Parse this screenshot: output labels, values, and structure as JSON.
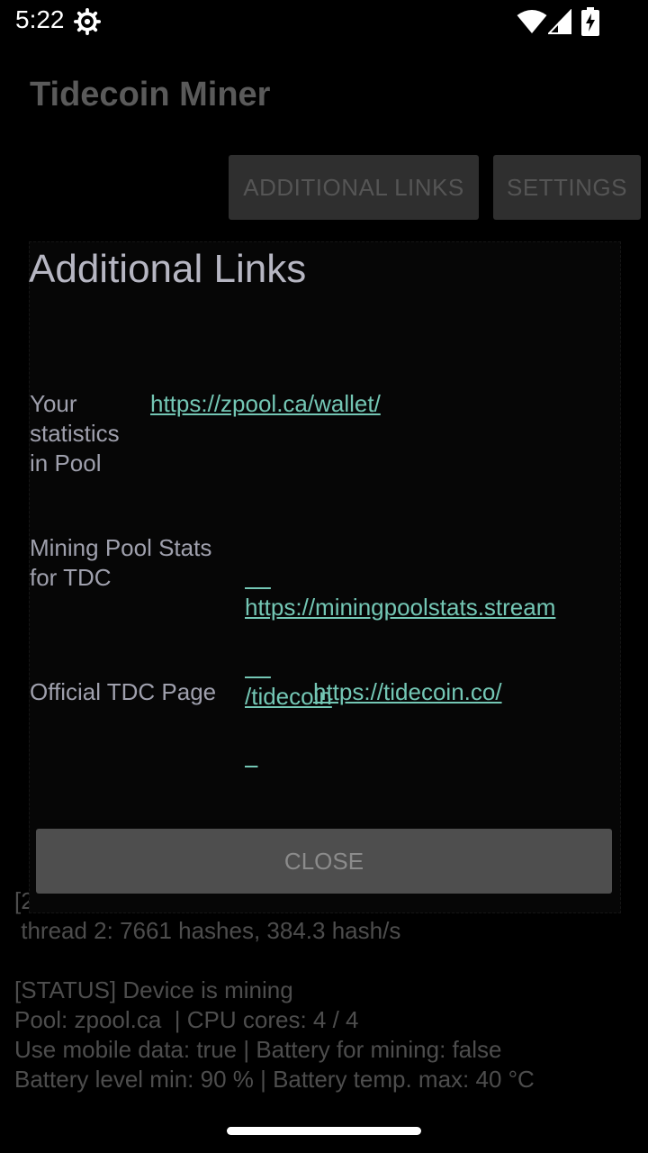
{
  "status_bar": {
    "time": "5:22",
    "icons": [
      "gear-icon",
      "wifi-icon",
      "signal-icon",
      "battery-charging-icon"
    ]
  },
  "app": {
    "title": "Tidecoin Miner",
    "buttons": {
      "additional_links": "ADDITIONAL LINKS",
      "settings": "SETTINGS"
    }
  },
  "log": {
    "partial_line": "[2",
    "thread_line": " thread 2: 7661 hashes, 384.3 hash/s",
    "status_line": "[STATUS] Device is mining",
    "pool_line": "Pool: zpool.ca  | CPU cores: 4 / 4",
    "mobile_line": "Use mobile data: true | Battery for mining: false",
    "battery_line": "Battery level min: 90 % | Battery temp. max: 40 °C"
  },
  "dialog": {
    "title": "Additional Links",
    "rows": [
      {
        "label_lines": [
          "Your",
          "statistics",
          "in Pool"
        ],
        "link": "https://zpool.ca/wallet/"
      },
      {
        "label_lines": [
          "Mining Pool Stats",
          "for TDC"
        ],
        "link_lines": [
          "https://miningpoolstats.stream",
          "/tidecoin"
        ]
      },
      {
        "label_lines": [
          "Official TDC Page"
        ],
        "link": "https://tidecoin.co/"
      }
    ],
    "close_label": "CLOSE"
  },
  "colors": {
    "background": "#000000",
    "link": "#74c7b5",
    "label": "#9fa0ad",
    "dialog_title": "#b6b6c2",
    "close_button": "#4e4e4e"
  }
}
